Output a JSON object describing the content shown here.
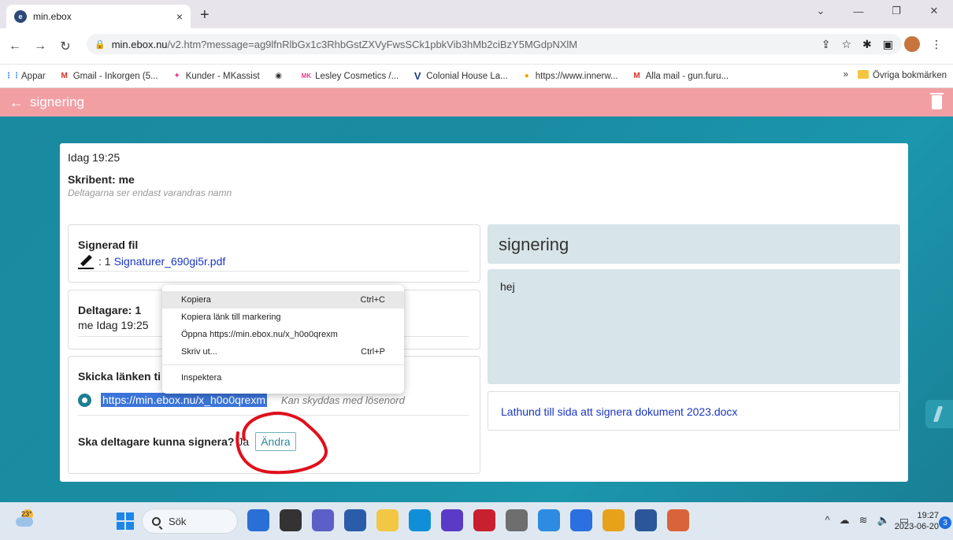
{
  "browser": {
    "tab_title": "min.ebox",
    "tab_close": "×",
    "new_tab": "+",
    "url_host": "min.ebox.nu",
    "url_path": "/v2.htm?message=ag9lfnRlbGx1c3RhbGstZXVyFwsSCk1pbkVib3hMb2ciBzY5MGdpNXlM",
    "bookmarks": [
      {
        "label": "Appar",
        "icon": "apps-grid-icon",
        "color": "#4285f4"
      },
      {
        "label": "Gmail - Inkorgen (5...",
        "icon": "gmail-icon",
        "color": "#d93025"
      },
      {
        "label": "Kunder - MKassist",
        "icon": "star-icon",
        "color": "#e8398a"
      },
      {
        "label": "",
        "icon": "globe-icon",
        "color": "#333333"
      },
      {
        "label": "Lesley Cosmetics /...",
        "icon": "mk-icon",
        "color": "#e8398a"
      },
      {
        "label": "Colonial House La...",
        "icon": "v-icon",
        "color": "#1a3a8c"
      },
      {
        "label": "https://www.innerw...",
        "icon": "circle-icon",
        "color": "#f0a500"
      },
      {
        "label": "Alla mail - gun.furu...",
        "icon": "gmail-icon",
        "color": "#d93025"
      }
    ],
    "bookmarks_more": "»",
    "other_bookmarks": "Övriga bokmärken"
  },
  "app": {
    "title": "signering",
    "back_icon": "arrow-left-icon",
    "delete_icon": "trash-icon"
  },
  "message": {
    "time": "Idag 19:25",
    "writer": "Skribent: me",
    "hint": "Deltagarna ser endast varandras namn",
    "signed_file_title": "Signerad fil",
    "signed_file_prefix": ": 1",
    "signed_file_name": "Signaturer_690gi5r.pdf",
    "participants_title": "Deltagare: 1",
    "participant_row": "me   Idag 19:25",
    "send_link_title": "Skicka länken ti",
    "share_link": "https://min.ebox.nu/x_h0o0qrexm",
    "share_note": "Kan skyddas med lösenord",
    "can_sign_label": "Ska deltagare kunna signera?",
    "can_sign_value": "Ja",
    "change_button": "Ändra",
    "subject": "signering",
    "body": "hej",
    "attachment": "Lathund till sida att signera dokument 2023.docx"
  },
  "context_menu": {
    "items": [
      {
        "label": "Kopiera",
        "shortcut": "Ctrl+C"
      },
      {
        "label": "Kopiera länk till markering",
        "shortcut": ""
      },
      {
        "label": "Öppna https://min.ebox.nu/x_h0o0qrexm",
        "shortcut": ""
      },
      {
        "label": "Skriv ut...",
        "shortcut": "Ctrl+P"
      },
      {
        "label": "Inspektera",
        "shortcut": ""
      }
    ]
  },
  "taskbar": {
    "temperature": "23°",
    "search_label": "Sök",
    "time": "19:27",
    "date": "2023-06-20",
    "notifications": "3",
    "app_colors": [
      "#2a6fd6",
      "#333333",
      "#5b5fc7",
      "#2a5caa",
      "#f2c744",
      "#0f8fd8",
      "#5a3bc7",
      "#c8202f",
      "#6e6e6e",
      "#2d8be0",
      "#2b6fe0",
      "#e8a21a",
      "#2b579a",
      "#d9643a"
    ]
  },
  "colors": {
    "header": "#f29fa3",
    "stage": "#1a8aa0",
    "link": "#1a35c4",
    "annotation": "#e0101c"
  }
}
